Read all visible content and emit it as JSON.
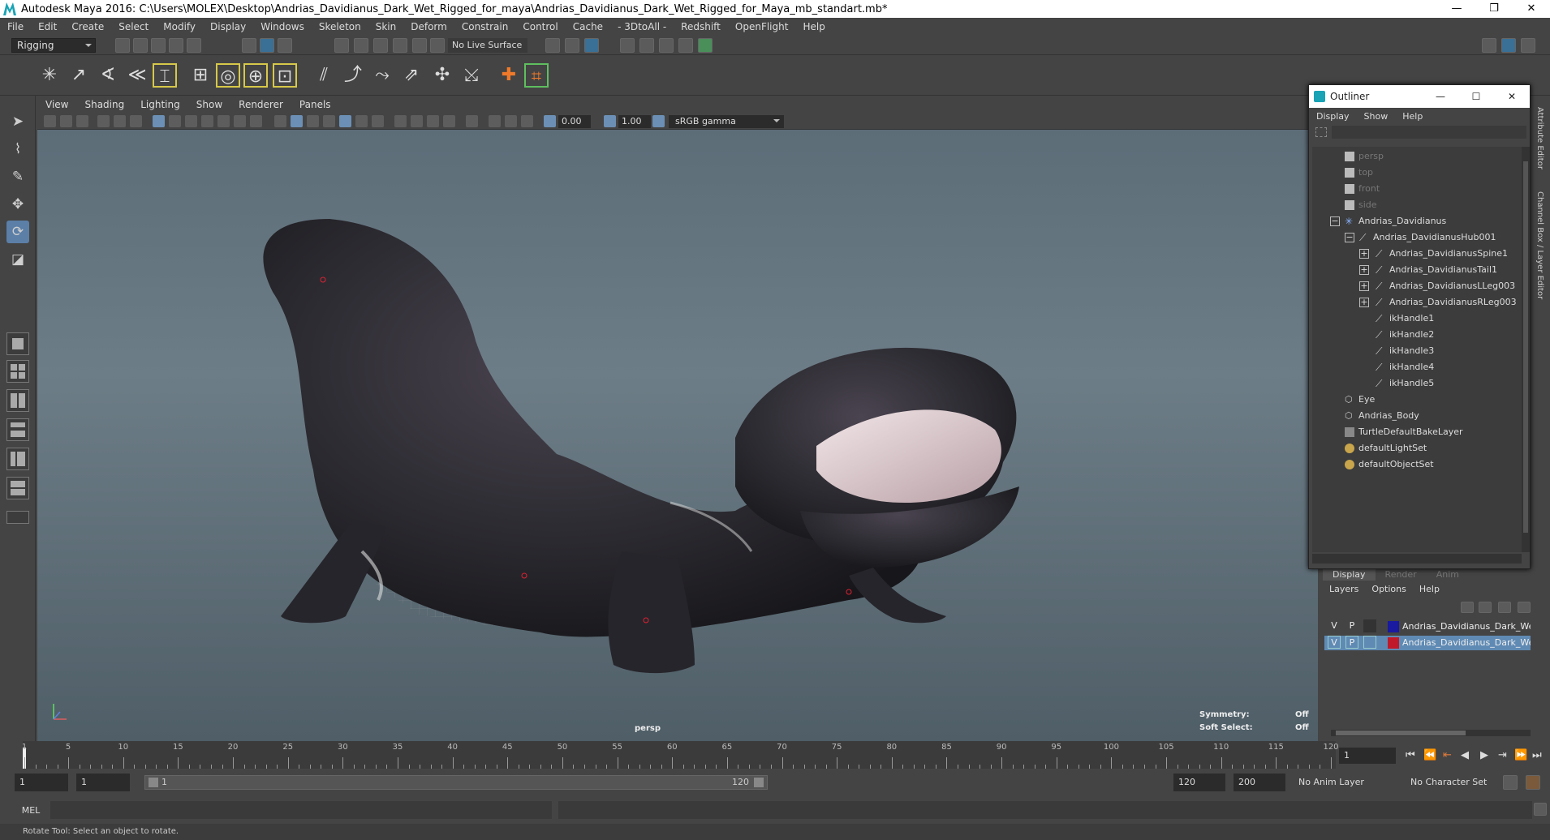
{
  "app": {
    "title": "Autodesk Maya 2016: C:\\Users\\MOLEX\\Desktop\\Andrias_Davidianus_Dark_Wet_Rigged_for_maya\\Andrias_Davidianus_Dark_Wet_Rigged_for_Maya_mb_standart.mb*",
    "window_controls": [
      "—",
      "❐",
      "✕"
    ]
  },
  "menubar": [
    "File",
    "Edit",
    "Create",
    "Select",
    "Modify",
    "Display",
    "Windows",
    "Skeleton",
    "Skin",
    "Deform",
    "Constrain",
    "Control",
    "Cache",
    "- 3DtoAll -",
    "Redshift",
    "OpenFlight",
    "Help"
  ],
  "status": {
    "menuset": "Rigging",
    "live_surface": "No Live Surface"
  },
  "viewport": {
    "menu": [
      "View",
      "Shading",
      "Lighting",
      "Show",
      "Renderer",
      "Panels"
    ],
    "exposure": "0.00",
    "gamma_value": "1.00",
    "colorspace": "sRGB gamma",
    "camera": "persp",
    "symmetry_label": "Symmetry:",
    "symmetry_value": "Off",
    "soft_select_label": "Soft Select:",
    "soft_select_value": "Off",
    "model_colors": {
      "body": "#2b2a30",
      "mouth": "#d9c5c8",
      "ground": "#5e6e78"
    }
  },
  "outliner": {
    "title": "Outliner",
    "window_controls": [
      "—",
      "☐",
      "✕"
    ],
    "menu": [
      "Display",
      "Show",
      "Help"
    ],
    "items": [
      {
        "label": "persp",
        "icon": "camera-icon"
      },
      {
        "label": "top",
        "icon": "camera-icon"
      },
      {
        "label": "front",
        "icon": "camera-icon"
      },
      {
        "label": "side",
        "icon": "camera-icon"
      },
      {
        "label": "Andrias_Davidianus",
        "icon": "joint-icon"
      },
      {
        "label": "Andrias_DavidianusHub001",
        "icon": "bone-icon"
      },
      {
        "label": "Andrias_DavidianusSpine1",
        "icon": "bone-icon"
      },
      {
        "label": "Andrias_DavidianusTail1",
        "icon": "bone-icon"
      },
      {
        "label": "Andrias_DavidianusLLeg003",
        "icon": "bone-icon"
      },
      {
        "label": "Andrias_DavidianusRLeg003",
        "icon": "bone-icon"
      },
      {
        "label": "ikHandle1",
        "icon": "ikhandle-icon"
      },
      {
        "label": "ikHandle2",
        "icon": "ikhandle-icon"
      },
      {
        "label": "ikHandle3",
        "icon": "ikhandle-icon"
      },
      {
        "label": "ikHandle4",
        "icon": "ikhandle-icon"
      },
      {
        "label": "ikHandle5",
        "icon": "ikhandle-icon"
      },
      {
        "label": "Eye",
        "icon": "mesh-icon"
      },
      {
        "label": "Andrias_Body",
        "icon": "mesh-icon"
      },
      {
        "label": "TurtleDefaultBakeLayer",
        "icon": "bake-layer-icon"
      },
      {
        "label": "defaultLightSet",
        "icon": "set-icon"
      },
      {
        "label": "defaultObjectSet",
        "icon": "set-icon"
      }
    ]
  },
  "layers": {
    "tabs": [
      "Display",
      "Render",
      "Anim"
    ],
    "menu": [
      "Layers",
      "Options",
      "Help"
    ],
    "rows": [
      {
        "v": "V",
        "p": "P",
        "name": "Andrias_Davidianus_Dark_Wet_R",
        "color": "#1a1aa0"
      },
      {
        "v": "V",
        "p": "P",
        "name": "Andrias_Davidianus_Dark_Wet_B",
        "color": "#c01a2a"
      }
    ]
  },
  "right_tabs": [
    "Attribute Editor",
    "Channel Box / Layer Editor"
  ],
  "timeline": {
    "ticks": [
      "1",
      "5",
      "10",
      "15",
      "20",
      "25",
      "30",
      "35",
      "40",
      "45",
      "50",
      "55",
      "60",
      "65",
      "70",
      "75",
      "80",
      "85",
      "90",
      "95",
      "100",
      "105",
      "110",
      "115",
      "120"
    ],
    "current_frame": "1"
  },
  "range": {
    "start": "1",
    "playback_start": "1",
    "slider_start": "1",
    "slider_end": "120",
    "playback_end": "120",
    "end": "200",
    "anim_layer": "No Anim Layer",
    "character_set": "No Character Set"
  },
  "command": {
    "lang": "MEL"
  },
  "helpline": "Rotate Tool: Select an object to rotate."
}
